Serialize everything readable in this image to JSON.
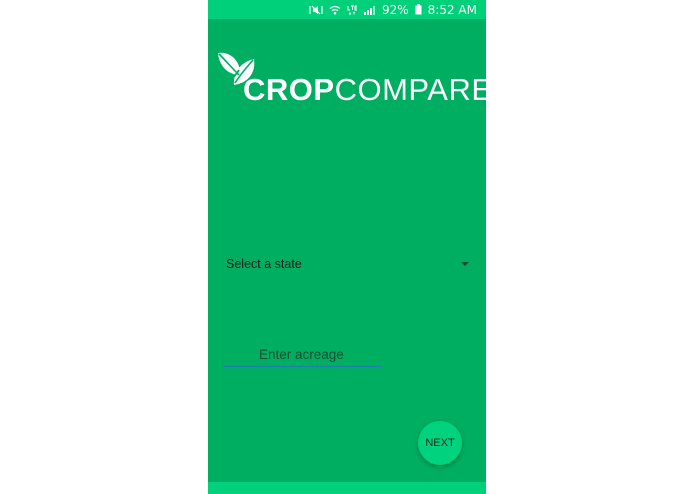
{
  "status_bar": {
    "battery_percent": "92%",
    "time": "8:52 AM",
    "icons": [
      "mute-icon",
      "wifi-icon",
      "lte-icon",
      "signal-icon",
      "battery-icon"
    ]
  },
  "logo": {
    "text_bold": "CROP",
    "text_light": "COMPARE"
  },
  "form": {
    "state_select_label": "Select a state",
    "acreage_placeholder": "Enter acreage",
    "acreage_value": ""
  },
  "actions": {
    "next_label": "NEXT"
  },
  "colors": {
    "background": "#00ae61",
    "status_bar": "#00d07a",
    "fab": "#00d27d",
    "input_underline": "#1f7fb0"
  }
}
